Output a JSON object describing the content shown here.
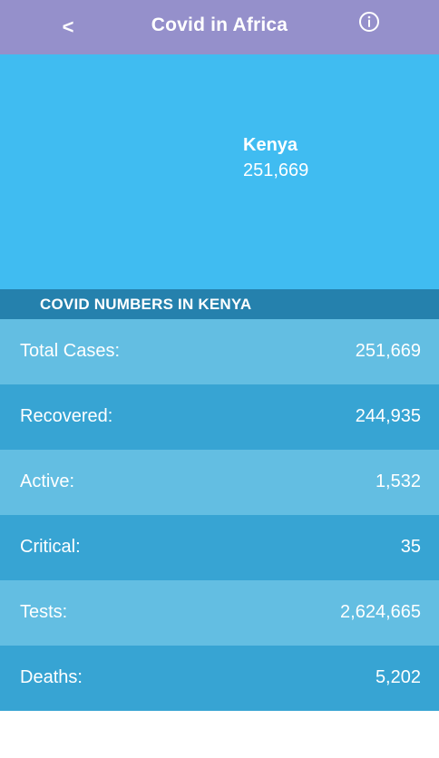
{
  "app_bar": {
    "back_label": "<",
    "title": "Covid in Africa",
    "info_icon": "info-circle-icon"
  },
  "hero": {
    "country": "Kenya",
    "total": "251,669"
  },
  "section": {
    "title": "COVID NUMBERS IN KENYA"
  },
  "stats": [
    {
      "label": "Total Cases:",
      "value": "251,669"
    },
    {
      "label": "Recovered:",
      "value": "244,935"
    },
    {
      "label": "Active:",
      "value": "1,532"
    },
    {
      "label": "Critical:",
      "value": "35"
    },
    {
      "label": "Tests:",
      "value": "2,624,665"
    },
    {
      "label": "Deaths:",
      "value": "5,202"
    }
  ],
  "colors": {
    "app_bar": "#9590cb",
    "hero": "#40bcf1",
    "section_header": "#2581ad",
    "row_light": "#63bee2",
    "row_dark": "#37a4d3"
  }
}
